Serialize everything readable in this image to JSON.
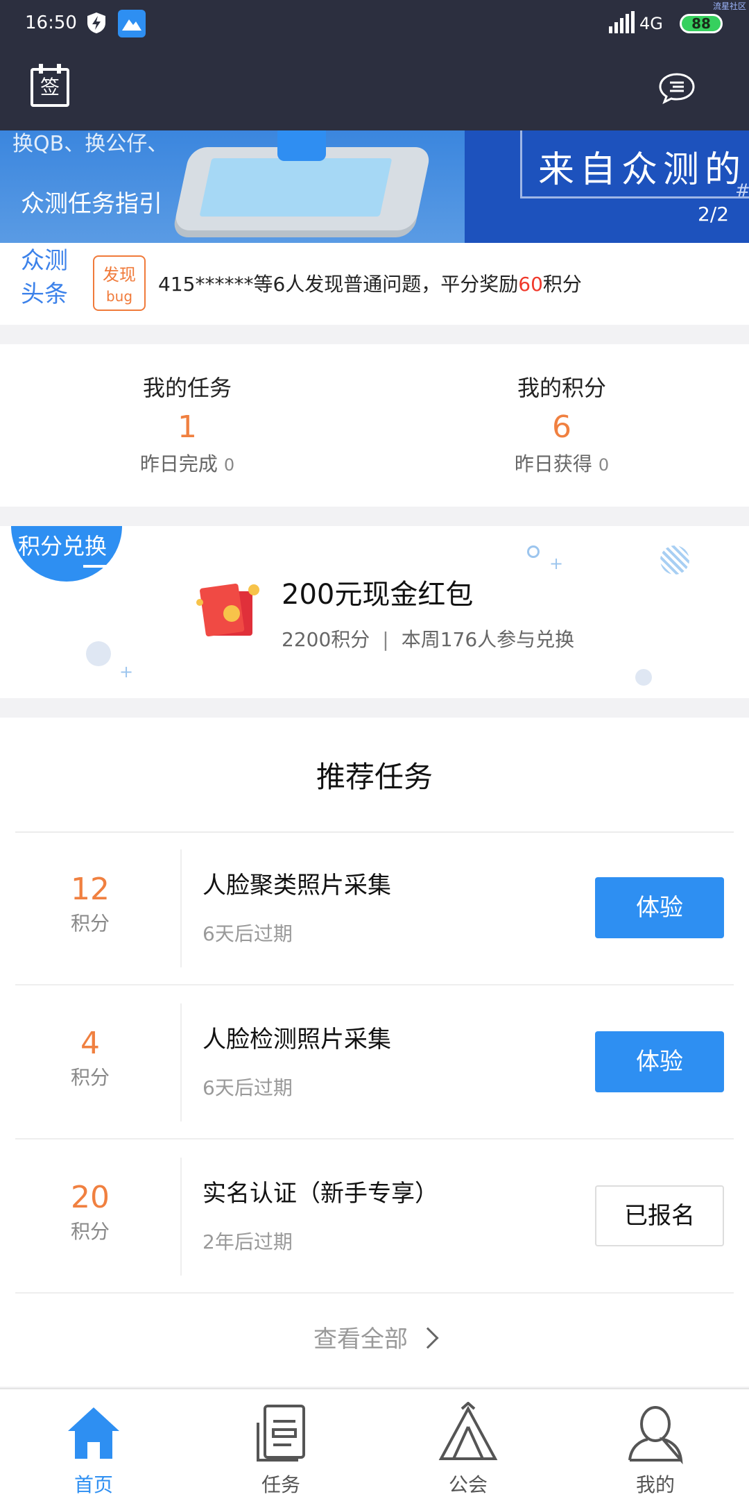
{
  "status_bar": {
    "time": "16:50",
    "network": "4G",
    "battery": "88",
    "corner_text": "流星社区"
  },
  "header": {
    "sign_label": "签"
  },
  "banner": {
    "subtitle": "换QB、换公仔、",
    "caption": "众测任务指引",
    "headline": "来自众测的",
    "counter": "2/2",
    "hash": "#"
  },
  "headline_bar": {
    "logo_line1": "众测",
    "logo_line2": "头条",
    "tag_line1": "发现",
    "tag_line2": "bug",
    "news_prefix": "415******等6人发现普通问题，平分奖励",
    "news_highlight": "60",
    "news_suffix": "积分"
  },
  "stats": {
    "tasks_label": "我的任务",
    "tasks_value": "1",
    "tasks_sub_label": "昨日完成",
    "tasks_sub_value": "0",
    "points_label": "我的积分",
    "points_value": "6",
    "points_sub_label": "昨日获得",
    "points_sub_value": "0"
  },
  "exchange": {
    "badge": "积分兑换",
    "item_title": "200元现金红包",
    "cost": "2200积分",
    "participants": "本周176人参与兑换",
    "separator": "|"
  },
  "recommend": {
    "title": "推荐任务",
    "tasks": [
      {
        "points": "12",
        "unit": "积分",
        "name": "人脸聚类照片采集",
        "expire": "6天后过期",
        "action": "体验"
      },
      {
        "points": "4",
        "unit": "积分",
        "name": "人脸检测照片采集",
        "expire": "6天后过期",
        "action": "体验"
      },
      {
        "points": "20",
        "unit": "积分",
        "name": "实名认证（新手专享）",
        "expire": "2年后过期",
        "action": "已报名"
      }
    ],
    "view_all": "查看全部"
  },
  "bottom_nav": [
    {
      "label": "首页",
      "icon": "home-icon",
      "active": true
    },
    {
      "label": "任务",
      "icon": "task-icon",
      "active": false
    },
    {
      "label": "公会",
      "icon": "guild-icon",
      "active": false
    },
    {
      "label": "我的",
      "icon": "profile-icon",
      "active": false
    }
  ],
  "colors": {
    "header_bg": "#2c2f3f",
    "accent_blue": "#2e8ff2",
    "accent_orange": "#f08040",
    "highlight_red": "#f0392b"
  }
}
